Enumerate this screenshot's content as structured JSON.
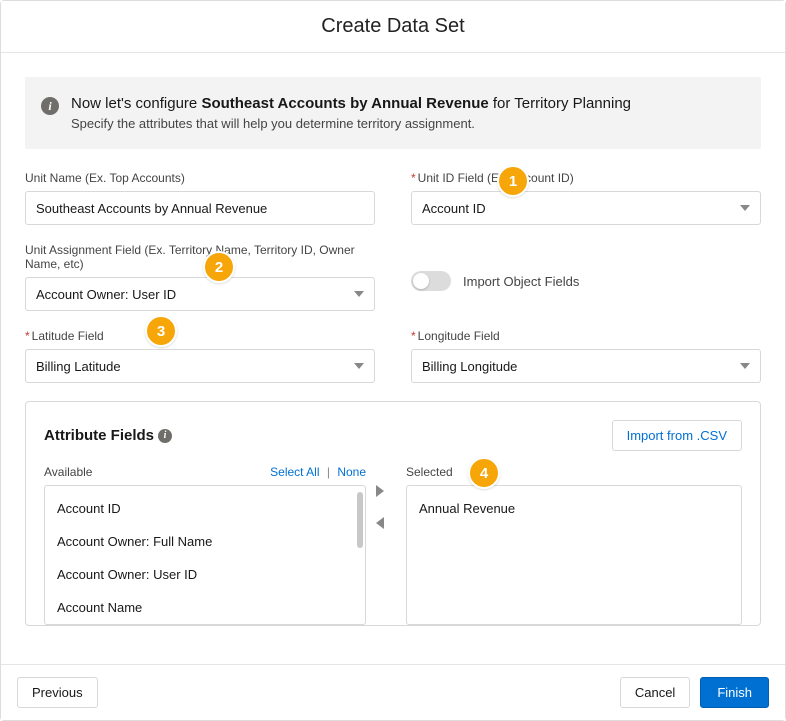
{
  "header": {
    "title": "Create Data Set"
  },
  "banner": {
    "prefix": "Now let's configure ",
    "emphasis": "Southeast Accounts by Annual Revenue",
    "suffix": " for Territory Planning",
    "sub": "Specify the attributes that will help you determine territory assignment."
  },
  "form": {
    "unit_name": {
      "label": "Unit Name (Ex. Top Accounts)",
      "value": "Southeast Accounts by Annual Revenue"
    },
    "unit_id": {
      "label": "Unit ID Field (Ex. Account ID)",
      "value": "Account ID",
      "required": true
    },
    "assignment": {
      "label": "Unit Assignment Field (Ex. Territory Name, Territory ID, Owner Name, etc)",
      "value": "Account Owner: User ID"
    },
    "import_toggle": {
      "label": "Import Object Fields",
      "on": false
    },
    "latitude": {
      "label": "Latitude Field",
      "value": "Billing Latitude",
      "required": true
    },
    "longitude": {
      "label": "Longitude Field",
      "value": "Billing Longitude",
      "required": true
    }
  },
  "attributes": {
    "title": "Attribute Fields",
    "import_csv": "Import from .CSV",
    "available_label": "Available",
    "selected_label": "Selected",
    "select_all": "Select All",
    "none": "None",
    "available": [
      "Account ID",
      "Account Owner: Full Name",
      "Account Owner: User ID",
      "Account Name"
    ],
    "selected": [
      "Annual Revenue"
    ]
  },
  "footer": {
    "previous": "Previous",
    "cancel": "Cancel",
    "finish": "Finish"
  },
  "callouts": {
    "c1": "1",
    "c2": "2",
    "c3": "3",
    "c4": "4"
  }
}
